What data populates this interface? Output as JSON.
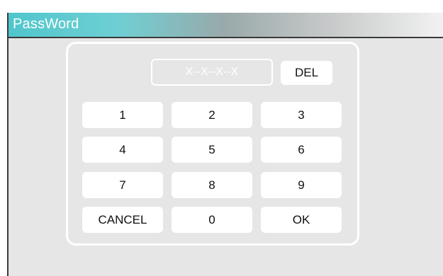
{
  "window": {
    "title": "PassWord"
  },
  "display": {
    "value": "X--X--X--X"
  },
  "keys": {
    "del": "DEL",
    "k1": "1",
    "k2": "2",
    "k3": "3",
    "k4": "4",
    "k5": "5",
    "k6": "6",
    "k7": "7",
    "k8": "8",
    "k9": "9",
    "cancel": "CANCEL",
    "k0": "0",
    "ok": "OK"
  },
  "colors": {
    "titlebar_accent": "#4fc6cc",
    "background": "#e6e6e6",
    "key": "#ffffff"
  }
}
